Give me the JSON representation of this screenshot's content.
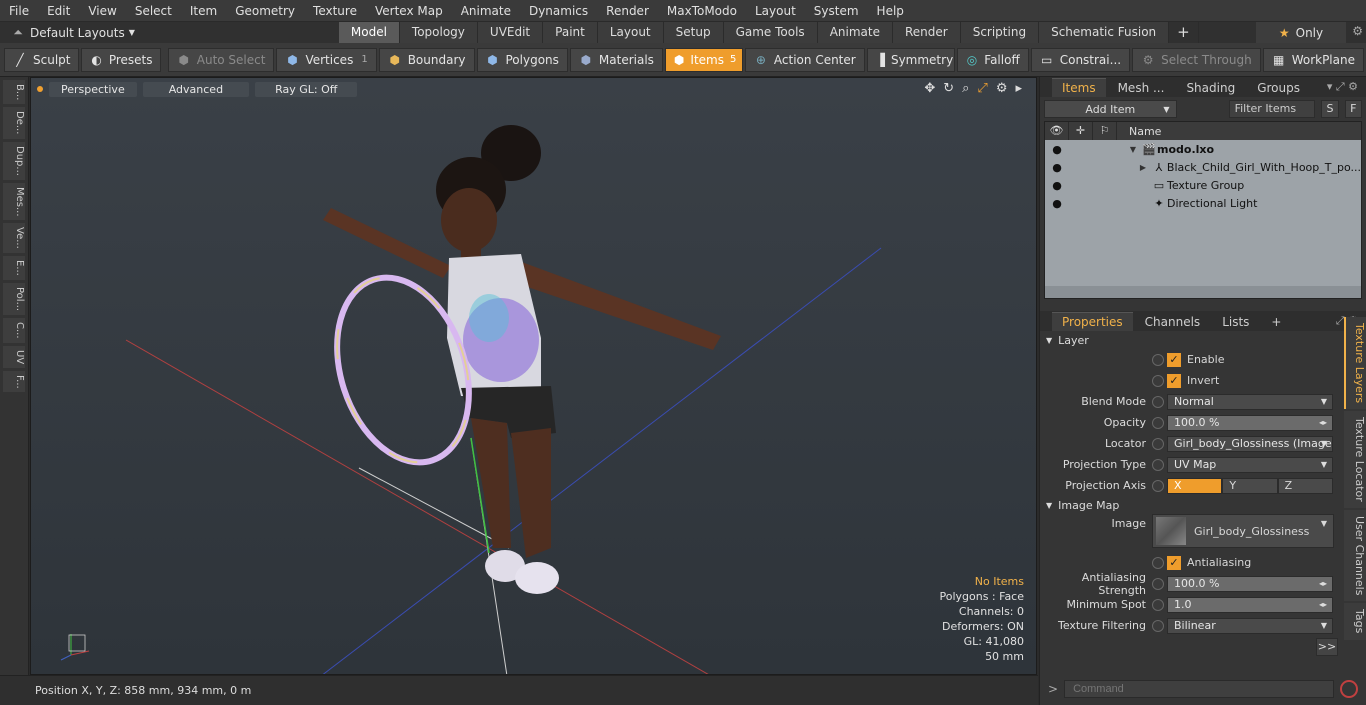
{
  "menu": [
    "File",
    "Edit",
    "View",
    "Select",
    "Item",
    "Geometry",
    "Texture",
    "Vertex Map",
    "Animate",
    "Dynamics",
    "Render",
    "MaxToModo",
    "Layout",
    "System",
    "Help"
  ],
  "layout": {
    "label": "Default Layouts"
  },
  "mode_tabs": [
    "Model",
    "Topology",
    "UVEdit",
    "Paint",
    "Layout",
    "Setup",
    "Game Tools",
    "Animate",
    "Render",
    "Scripting",
    "Schematic Fusion"
  ],
  "active_mode_tab": "Model",
  "only_label": "Only",
  "toolbar": {
    "sculpt": "Sculpt",
    "presets": "Presets",
    "auto_select": "Auto Select",
    "vertices": "Vertices",
    "vertices_count": "1",
    "boundary": "Boundary",
    "polygons": "Polygons",
    "materials": "Materials",
    "items": "Items",
    "items_count": "5",
    "action_center": "Action Center",
    "symmetry": "Symmetry",
    "falloff": "Falloff",
    "constraints": "Constrai...",
    "select_through": "Select Through",
    "workplane": "WorkPlane"
  },
  "left_strip": [
    "B...",
    "De...",
    "Dup...",
    "Mes...",
    "Ve...",
    "E...",
    "Pol...",
    "C...",
    "UV",
    "F..."
  ],
  "viewport": {
    "perspective": "Perspective",
    "advanced": "Advanced",
    "raygl": "Ray GL: Off",
    "stats": {
      "no_items": "No Items",
      "polygons": "Polygons : Face",
      "channels": "Channels: 0",
      "deformers": "Deformers: ON",
      "gl": "GL: 41,080",
      "size": "50 mm"
    }
  },
  "statusbar": {
    "position": "Position X, Y, Z:  858 mm, 934 mm, 0 m"
  },
  "items_panel": {
    "tabs": [
      "Items",
      "Mesh ...",
      "Shading",
      "Groups"
    ],
    "add_item": "Add Item",
    "filter": "Filter Items",
    "s": "S",
    "f": "F",
    "name_header": "Name",
    "rows": [
      {
        "label": "modo.lxo"
      },
      {
        "label": "Black_Child_Girl_With_Hoop_T_po..."
      },
      {
        "label": "Texture Group"
      },
      {
        "label": "Directional Light"
      }
    ]
  },
  "props_panel": {
    "tabs": [
      "Properties",
      "Channels",
      "Lists"
    ],
    "layer_section": "Layer",
    "enable": "Enable",
    "invert": "Invert",
    "blend_mode": {
      "label": "Blend Mode",
      "value": "Normal"
    },
    "opacity": {
      "label": "Opacity",
      "value": "100.0 %"
    },
    "locator": {
      "label": "Locator",
      "value": "Girl_body_Glossiness (Image) ( ..."
    },
    "projection_type": {
      "label": "Projection Type",
      "value": "UV Map"
    },
    "projection_axis": {
      "label": "Projection Axis",
      "x": "X",
      "y": "Y",
      "z": "Z"
    },
    "image_map_section": "Image Map",
    "image": {
      "label": "Image",
      "value": "Girl_body_Glossiness"
    },
    "antialiasing": "Antialiasing",
    "aa_strength": {
      "label": "Antialiasing Strength",
      "value": "100.0 %"
    },
    "min_spot": {
      "label": "Minimum Spot",
      "value": "1.0"
    },
    "tex_filter": {
      "label": "Texture Filtering",
      "value": "Bilinear"
    },
    "more": ">>",
    "side_tabs": [
      "Texture Layers",
      "Texture Locator",
      "User Channels",
      "Tags"
    ]
  },
  "command": {
    "placeholder": "Command"
  }
}
